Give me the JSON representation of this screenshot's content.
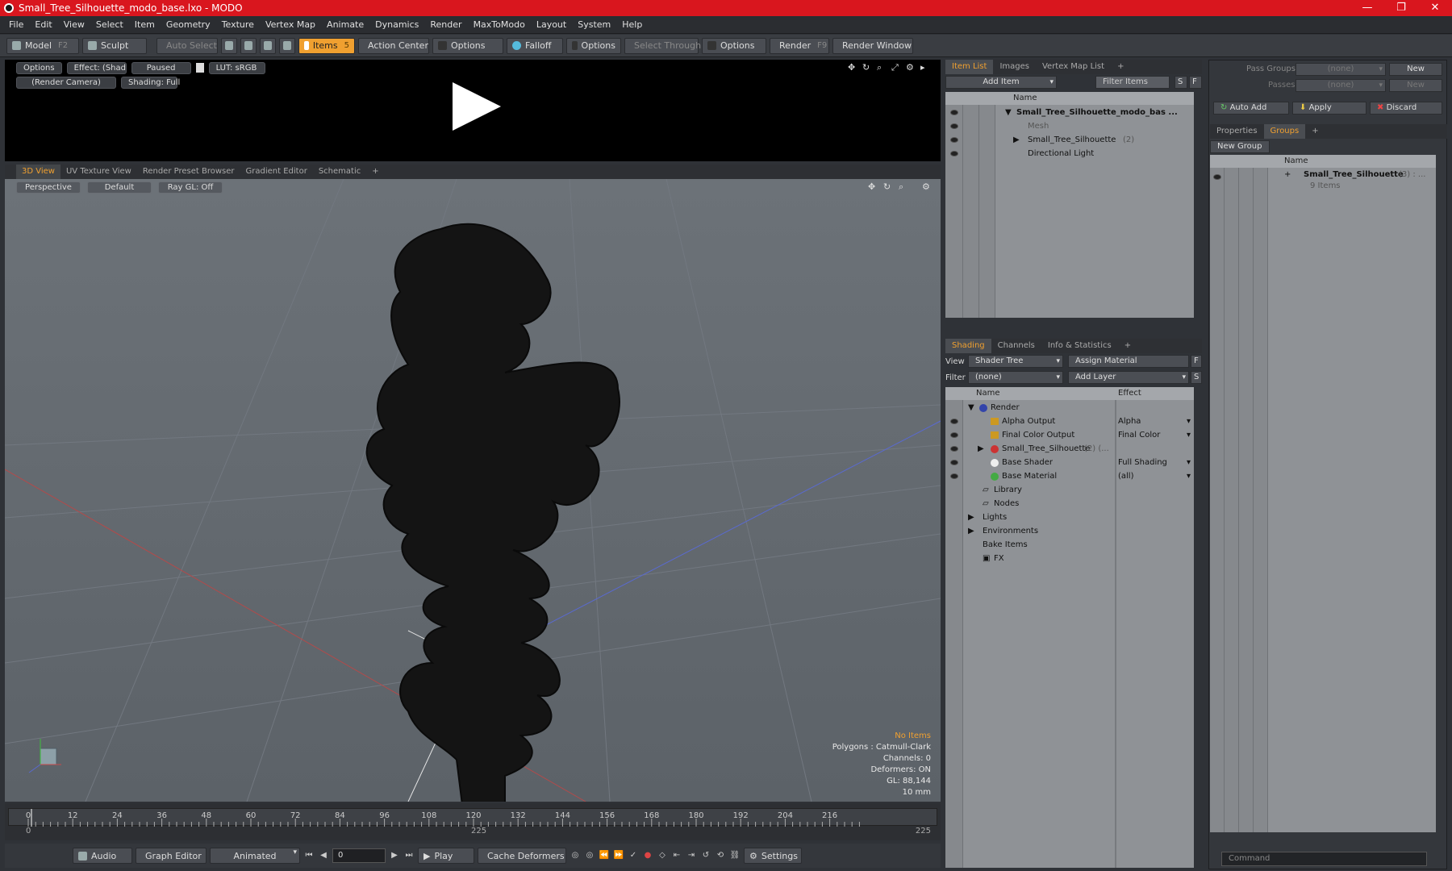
{
  "window": {
    "title": "Small_Tree_Silhouette_modo_base.lxo - MODO",
    "minimize": "—",
    "maximize": "❐",
    "close": "✕"
  },
  "menu": [
    "File",
    "Edit",
    "View",
    "Select",
    "Item",
    "Geometry",
    "Texture",
    "Vertex Map",
    "Animate",
    "Dynamics",
    "Render",
    "MaxToModo",
    "Layout",
    "System",
    "Help"
  ],
  "toolbar": {
    "model": "Model",
    "model_key": "F2",
    "sculpt": "Sculpt",
    "auto_select": "Auto Select",
    "items": "Items",
    "items_key": "5",
    "action_center": "Action Center",
    "options1": "Options",
    "falloff": "Falloff",
    "options2": "Options",
    "select_through": "Select Through",
    "options3": "Options",
    "render": "Render",
    "render_key": "F9",
    "render_window": "Render Window"
  },
  "render_view": {
    "options": "Options",
    "effect": "Effect: (Shadi...",
    "paused": "Paused",
    "lut": "LUT: sRGB",
    "camera": "(Render Camera)",
    "shading": "Shading: Full"
  },
  "view_tabs": [
    "3D View",
    "UV Texture View",
    "Render Preset Browser",
    "Gradient Editor",
    "Schematic",
    "+"
  ],
  "viewport": {
    "projection": "Perspective",
    "style": "Default",
    "raygl": "Ray GL: Off"
  },
  "stats": {
    "items": "No Items",
    "polygons": "Polygons : Catmull-Clark",
    "channels": "Channels: 0",
    "deformers": "Deformers: ON",
    "gl": "GL: 88,144",
    "unit": "10 mm"
  },
  "timeline": {
    "ticks": [
      "0",
      "12",
      "24",
      "36",
      "48",
      "60",
      "72",
      "84",
      "96",
      "108",
      "120",
      "132",
      "144",
      "156",
      "168",
      "180",
      "192",
      "204",
      "216"
    ],
    "start": "0",
    "mid": "225",
    "end": "225"
  },
  "transport": {
    "audio": "Audio",
    "graph_editor": "Graph Editor",
    "animated": "Animated",
    "frame": "0",
    "play": "Play",
    "cache_deformers": "Cache Deformers",
    "settings": "Settings"
  },
  "item_list": {
    "tabs": [
      "Item List",
      "Images",
      "Vertex Map List",
      "+"
    ],
    "add_item": "Add Item",
    "filter": "Filter Items",
    "s": "S",
    "f": "F",
    "name_col": "Name",
    "rows": [
      {
        "label": "Small_Tree_Silhouette_modo_bas ...",
        "extra": ""
      },
      {
        "label": "Mesh",
        "extra": ""
      },
      {
        "label": "Small_Tree_Silhouette",
        "extra": "(2)"
      },
      {
        "label": "Directional Light",
        "extra": ""
      }
    ]
  },
  "shading": {
    "tabs": [
      "Shading",
      "Channels",
      "Info & Statistics",
      "+"
    ],
    "view_label": "View",
    "view_value": "Shader Tree",
    "assign": "Assign Material",
    "f": "F",
    "filter_label": "Filter",
    "filter_value": "(none)",
    "add_layer": "Add Layer",
    "s": "S",
    "name_col": "Name",
    "effect_col": "Effect",
    "rows": [
      {
        "label": "Render",
        "effect": ""
      },
      {
        "label": "Alpha Output",
        "effect": "Alpha"
      },
      {
        "label": "Final Color Output",
        "effect": "Final Color"
      },
      {
        "label": "Small_Tree_Silhouette",
        "extra": "(2) (...",
        "effect": ""
      },
      {
        "label": "Base Shader",
        "effect": "Full Shading"
      },
      {
        "label": "Base Material",
        "effect": "(all)"
      },
      {
        "label": "Library",
        "effect": ""
      },
      {
        "label": "Nodes",
        "effect": ""
      },
      {
        "label": "Lights",
        "effect": ""
      },
      {
        "label": "Environments",
        "effect": ""
      },
      {
        "label": "Bake Items",
        "effect": ""
      },
      {
        "label": "FX",
        "effect": ""
      }
    ]
  },
  "groups": {
    "pass_groups": "Pass Groups",
    "pass_value": "(none)",
    "new1": "New",
    "passes": "Passes",
    "passes_value": "(none)",
    "new2": "New",
    "auto_add": "Auto Add",
    "apply": "Apply",
    "discard": "Discard",
    "tabs": [
      "Properties",
      "Groups",
      "+"
    ],
    "new_group": "New Group",
    "name_col": "Name",
    "row_label": "Small_Tree_Silhouette",
    "row_extra": "(3) : ...",
    "row_sub": "9 Items"
  },
  "command": {
    "placeholder": "Command"
  }
}
